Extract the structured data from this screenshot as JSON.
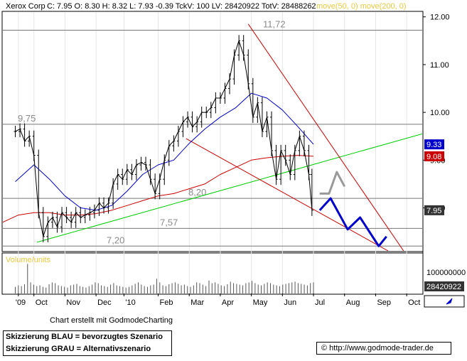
{
  "header": {
    "title": "Xerox Corp",
    "quote": "C: 7.95  O: 8.30  H: 8.32  L: 7.93  -0.39  TckV: 100  LV: 28420922  TotV: 28488262",
    "ma_legend": "move(50, 0)  move(200, 0)"
  },
  "colors": {
    "price": "#000000",
    "ma50": "#0000cc",
    "ma200": "#cc0000",
    "support_green": "#00cc00",
    "channel_red": "#cc0000",
    "scenario_blue": "#0000cc",
    "scenario_grey": "#999999",
    "level_line": "#777777",
    "ma_legend_text": "#e8c840"
  },
  "chart_data": {
    "type": "line",
    "title": "Xerox Corp",
    "x_tick_labels": [
      "'09",
      "Oct",
      "Nov",
      "Dec",
      "'10",
      "Feb",
      "Mar",
      "Apr",
      "May",
      "Jun",
      "Jul",
      "Aug",
      "Sep",
      "Oct"
    ],
    "x_tick_positions_month": [
      0.5,
      1,
      2,
      3,
      3.9,
      5,
      6,
      7,
      8,
      9,
      10,
      11,
      12,
      13
    ],
    "y_tick_labels": [
      "8.00",
      "9.00",
      "10.00",
      "11.00",
      "12.00"
    ],
    "y_ticks": [
      8,
      9,
      10,
      11,
      12
    ],
    "ylim": [
      7.1,
      12.1
    ],
    "xlim": [
      0,
      13.5
    ],
    "price_series": {
      "name": "Xerox Corp",
      "x": [
        0.4,
        0.55,
        0.7,
        0.85,
        1.0,
        1.15,
        1.3,
        1.45,
        1.6,
        1.75,
        1.9,
        2.05,
        2.2,
        2.35,
        2.5,
        2.65,
        2.8,
        2.95,
        3.1,
        3.25,
        3.4,
        3.55,
        3.7,
        3.85,
        4.0,
        4.15,
        4.3,
        4.45,
        4.6,
        4.75,
        4.9,
        5.05,
        5.2,
        5.35,
        5.5,
        5.65,
        5.8,
        5.95,
        6.1,
        6.25,
        6.4,
        6.55,
        6.7,
        6.85,
        7.0,
        7.15,
        7.3,
        7.45,
        7.6,
        7.75,
        7.9,
        8.05,
        8.2,
        8.35,
        8.5,
        8.65,
        8.8,
        8.95,
        9.1,
        9.25,
        9.4,
        9.55,
        9.7,
        9.85,
        9.95
      ],
      "values": [
        9.6,
        9.65,
        9.4,
        9.5,
        9.1,
        7.9,
        7.4,
        7.7,
        7.8,
        7.6,
        7.9,
        7.8,
        7.7,
        7.9,
        7.8,
        7.85,
        7.9,
        7.95,
        8.1,
        8.0,
        8.1,
        8.5,
        8.7,
        8.6,
        8.8,
        8.7,
        8.9,
        8.95,
        8.9,
        8.6,
        8.3,
        8.6,
        9.0,
        9.3,
        9.4,
        9.6,
        9.8,
        9.9,
        9.7,
        9.8,
        10.0,
        10.0,
        10.1,
        10.3,
        10.3,
        10.5,
        10.7,
        11.2,
        11.5,
        11.2,
        10.6,
        9.9,
        10.2,
        9.6,
        9.9,
        9.2,
        8.6,
        9.2,
        9.0,
        8.7,
        9.2,
        9.5,
        9.2,
        8.7,
        7.95
      ]
    },
    "ma50_series": {
      "name": "move(50, 0)",
      "x": [
        0.4,
        1.0,
        1.5,
        2.0,
        2.5,
        3.0,
        3.5,
        4.0,
        4.5,
        5.0,
        5.5,
        6.0,
        6.5,
        7.0,
        7.5,
        8.0,
        8.5,
        9.0,
        9.5,
        10.0
      ],
      "values": [
        8.55,
        8.9,
        8.6,
        8.25,
        8.0,
        7.95,
        8.05,
        8.35,
        8.7,
        8.9,
        9.0,
        9.35,
        9.65,
        9.9,
        10.1,
        10.4,
        10.3,
        10.05,
        9.7,
        9.33
      ]
    },
    "ma200_series": {
      "name": "move(200, 0)",
      "x": [
        0.0,
        0.5,
        1.0,
        1.5,
        2.0,
        2.5,
        3.0,
        3.5,
        4.0,
        4.5,
        5.0,
        5.5,
        6.0,
        6.5,
        7.0,
        7.5,
        8.0,
        8.5,
        9.0,
        9.5,
        10.0
      ],
      "values": [
        7.7,
        7.85,
        7.9,
        7.9,
        7.85,
        7.85,
        7.88,
        7.95,
        8.05,
        8.15,
        8.25,
        8.3,
        8.4,
        8.5,
        8.7,
        8.85,
        9.0,
        9.05,
        9.08,
        9.1,
        9.08
      ]
    },
    "trendlines": [
      {
        "name": "support",
        "color": "#00cc00",
        "x": [
          1.1,
          13.5
        ],
        "values": [
          7.28,
          9.55
        ]
      },
      {
        "name": "channel-upper",
        "color": "#cc0000",
        "x": [
          7.9,
          12.9
        ],
        "values": [
          11.85,
          7.1
        ]
      },
      {
        "name": "channel-lower",
        "color": "#cc0000",
        "x": [
          5.9,
          12.4
        ],
        "values": [
          9.45,
          7.1
        ]
      }
    ],
    "horizontal_levels": [
      {
        "label": "11,72",
        "value": 11.72
      },
      {
        "label": "9,75",
        "value": 9.75
      },
      {
        "label": "8,20",
        "value": 8.2
      },
      {
        "label": "7,57",
        "value": 7.57
      },
      {
        "label": "7,20",
        "value": 7.2
      }
    ],
    "scenario_blue": {
      "name": "Skizzierung BLAU",
      "x": [
        10.2,
        10.55,
        11.1,
        11.5,
        12.1,
        12.35
      ],
      "values": [
        7.95,
        8.2,
        7.55,
        7.8,
        7.2,
        7.4
      ]
    },
    "scenario_grey": {
      "name": "Skizzierung GRAU",
      "x": [
        10.2,
        10.5,
        10.75,
        11.0
      ],
      "values": [
        8.3,
        8.3,
        8.75,
        8.45
      ]
    },
    "right_badges": [
      {
        "label": "9.33",
        "value": 9.33,
        "bg": "#0000cc",
        "fg": "#ffffff"
      },
      {
        "label": "9.08",
        "value": 9.08,
        "bg": "#cc0000",
        "fg": "#ffffff"
      },
      {
        "label": "7.95",
        "value": 7.95,
        "bg": "#333333",
        "fg": "#ffffff"
      }
    ],
    "volume_panel": {
      "title": "Volume/units",
      "y_tick_label": "100000000",
      "current_label": "28420922",
      "max": 100000000,
      "bars": [
        18,
        22,
        20,
        25,
        80,
        30,
        24,
        20,
        22,
        18,
        16,
        25,
        30,
        28,
        22,
        20,
        18,
        16,
        22,
        24,
        26,
        20,
        18,
        16,
        20,
        24,
        30,
        28,
        22,
        20,
        18,
        24,
        28,
        22,
        20,
        18,
        16,
        18,
        22,
        26,
        30,
        24,
        20,
        18,
        22,
        24,
        40,
        30,
        22,
        20,
        25,
        28,
        30,
        26,
        22,
        24,
        20,
        18,
        22,
        30,
        28,
        24,
        20,
        35,
        28,
        30,
        26,
        22,
        20,
        25,
        32,
        28,
        26,
        24,
        22,
        28,
        30,
        34,
        28,
        24,
        22,
        26,
        30,
        28,
        24,
        22,
        20,
        24,
        26,
        28,
        30,
        32,
        28,
        26,
        24,
        22,
        28,
        30
      ]
    }
  },
  "footer": {
    "credit": "Chart erstellt mit GodmodeCharting",
    "legend_blue": "Skizzierung BLAU = bevorzugtes Szenario",
    "legend_grey": "Skizzierung GRAU = Alternativszenario",
    "url": "http://www.godmode-trader.de"
  }
}
